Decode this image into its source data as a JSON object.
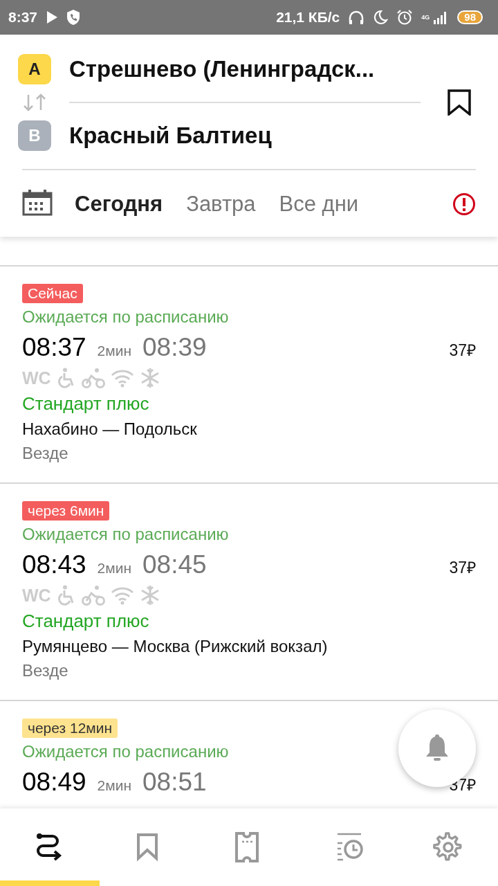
{
  "status_bar": {
    "time": "8:37",
    "speed": "21,1 КБ/с",
    "network": "4G",
    "battery": "98"
  },
  "route": {
    "from": {
      "badge": "A",
      "name": "Стрешнево (Ленинградск..."
    },
    "to": {
      "badge": "B",
      "name": "Красный Балтиец"
    }
  },
  "dates": [
    {
      "label": "Сегодня",
      "selected": true
    },
    {
      "label": "Завтра",
      "selected": false
    },
    {
      "label": "Все дни",
      "selected": false
    }
  ],
  "trips": [
    {
      "badge": {
        "text": "Сейчас",
        "kind": "urgent"
      },
      "status": "Ожидается по расписанию",
      "departure": "08:37",
      "duration": "2мин",
      "arrival": "08:39",
      "price": "37₽",
      "wc": "WC",
      "train_type": "Стандарт плюс",
      "route": "Нахабино — Подольск",
      "stops": "Везде"
    },
    {
      "badge": {
        "text": "через 6мин",
        "kind": "urgent"
      },
      "status": "Ожидается по расписанию",
      "departure": "08:43",
      "duration": "2мин",
      "arrival": "08:45",
      "price": "37₽",
      "wc": "WC",
      "train_type": "Стандарт плюс",
      "route": "Румянцево — Москва (Рижский вокзал)",
      "stops": "Везде"
    },
    {
      "badge": {
        "text": "через 12мин",
        "kind": "upcoming"
      },
      "status": "Ожидается по расписанию",
      "departure": "08:49",
      "duration": "2мин",
      "arrival": "08:51",
      "price": "37₽"
    }
  ],
  "nav": [
    {
      "kind": "route",
      "selected": true
    },
    {
      "kind": "favorites",
      "selected": false
    },
    {
      "kind": "tickets",
      "selected": false
    },
    {
      "kind": "history",
      "selected": false
    },
    {
      "kind": "settings",
      "selected": false
    }
  ]
}
